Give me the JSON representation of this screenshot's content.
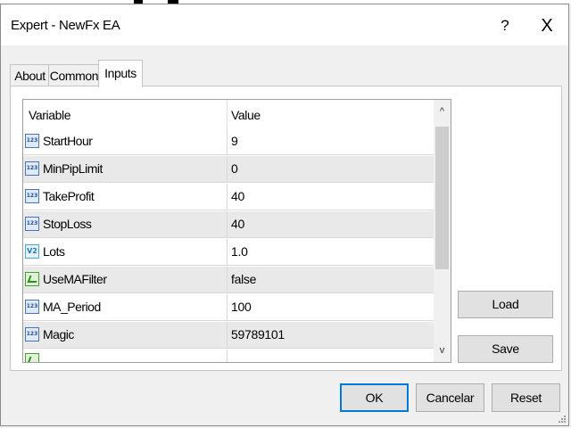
{
  "window": {
    "title": "Expert - NewFx EA",
    "help_label": "?",
    "close_label": "X"
  },
  "tabs": [
    {
      "label": "About",
      "active": false
    },
    {
      "label": "Common",
      "active": false
    },
    {
      "label": "Inputs",
      "active": true
    }
  ],
  "grid": {
    "headers": {
      "variable": "Variable",
      "value": "Value"
    },
    "rows": [
      {
        "icon": "int-icon",
        "icon_text": "123",
        "variable": "StartHour",
        "value": "9"
      },
      {
        "icon": "int-icon",
        "icon_text": "123",
        "variable": "MinPipLimit",
        "value": "0"
      },
      {
        "icon": "int-icon",
        "icon_text": "123",
        "variable": "TakeProfit",
        "value": "40"
      },
      {
        "icon": "int-icon",
        "icon_text": "123",
        "variable": "StopLoss",
        "value": "40"
      },
      {
        "icon": "double-icon",
        "icon_text": "V2",
        "variable": "Lots",
        "value": "1.0"
      },
      {
        "icon": "bool-icon",
        "icon_text": "",
        "variable": "UseMAFilter",
        "value": "false"
      },
      {
        "icon": "int-icon",
        "icon_text": "123",
        "variable": "MA_Period",
        "value": "100"
      },
      {
        "icon": "int-icon",
        "icon_text": "123",
        "variable": "Magic",
        "value": "59789101"
      }
    ],
    "scroll_up_glyph": "^",
    "scroll_down_glyph": "v"
  },
  "side_buttons": {
    "load": "Load",
    "save": "Save"
  },
  "bottom_buttons": {
    "ok": "OK",
    "cancel": "Cancelar",
    "reset": "Reset"
  },
  "colors": {
    "accent": "#0078d7",
    "alt_row": "#e9e9e9"
  }
}
